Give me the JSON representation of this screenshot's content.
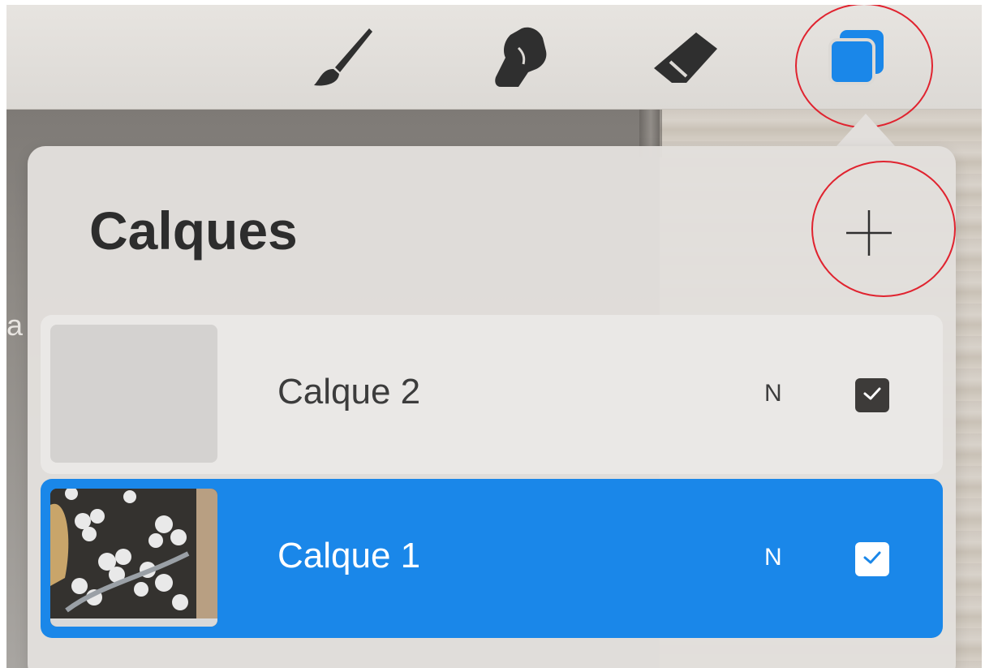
{
  "toolbar": {
    "tools": [
      {
        "name": "brush",
        "icon": "brush-icon"
      },
      {
        "name": "smudge",
        "icon": "smudge-finger-icon"
      },
      {
        "name": "eraser",
        "icon": "eraser-icon"
      },
      {
        "name": "layers",
        "icon": "layers-icon",
        "active": true
      }
    ],
    "active_color": "#1a87e9"
  },
  "layers_panel": {
    "title": "Calques",
    "add_icon": "plus-icon",
    "layers": [
      {
        "name": "Calque 2",
        "blend_mode": "N",
        "visible": true,
        "selected": false,
        "thumbnail": "empty"
      },
      {
        "name": "Calque 1",
        "blend_mode": "N",
        "visible": true,
        "selected": true,
        "thumbnail": "photo"
      }
    ]
  },
  "annotations": {
    "circle_color": "#e0232f",
    "circled": [
      "layers-button",
      "add-layer-button"
    ]
  },
  "background": {
    "partial_letter": "a"
  }
}
